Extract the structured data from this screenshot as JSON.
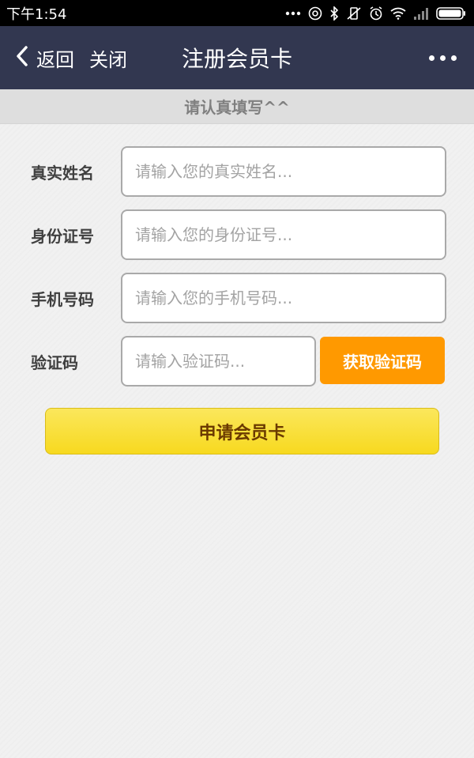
{
  "status_bar": {
    "time": "下午1:54",
    "icons": [
      "more-dots-icon",
      "at-icon",
      "bluetooth-icon",
      "vibrate-off-icon",
      "alarm-icon",
      "wifi-icon",
      "signal-icon",
      "battery-icon"
    ]
  },
  "nav": {
    "back_label": "返回",
    "close_label": "关闭",
    "title": "注册会员卡"
  },
  "notice": "请认真填写^^",
  "form": {
    "fields": [
      {
        "label": "真实姓名",
        "placeholder": "请输入您的真实姓名..."
      },
      {
        "label": "身份证号",
        "placeholder": "请输入您的身份证号..."
      },
      {
        "label": "手机号码",
        "placeholder": "请输入您的手机号码..."
      },
      {
        "label": "验证码",
        "placeholder": "请输入验证码..."
      }
    ],
    "get_code_label": "获取验证码",
    "submit_label": "申请会员卡"
  },
  "colors": {
    "nav_bg": "#323750",
    "code_button": "#ff9900",
    "submit_button": "#f7d91f"
  }
}
